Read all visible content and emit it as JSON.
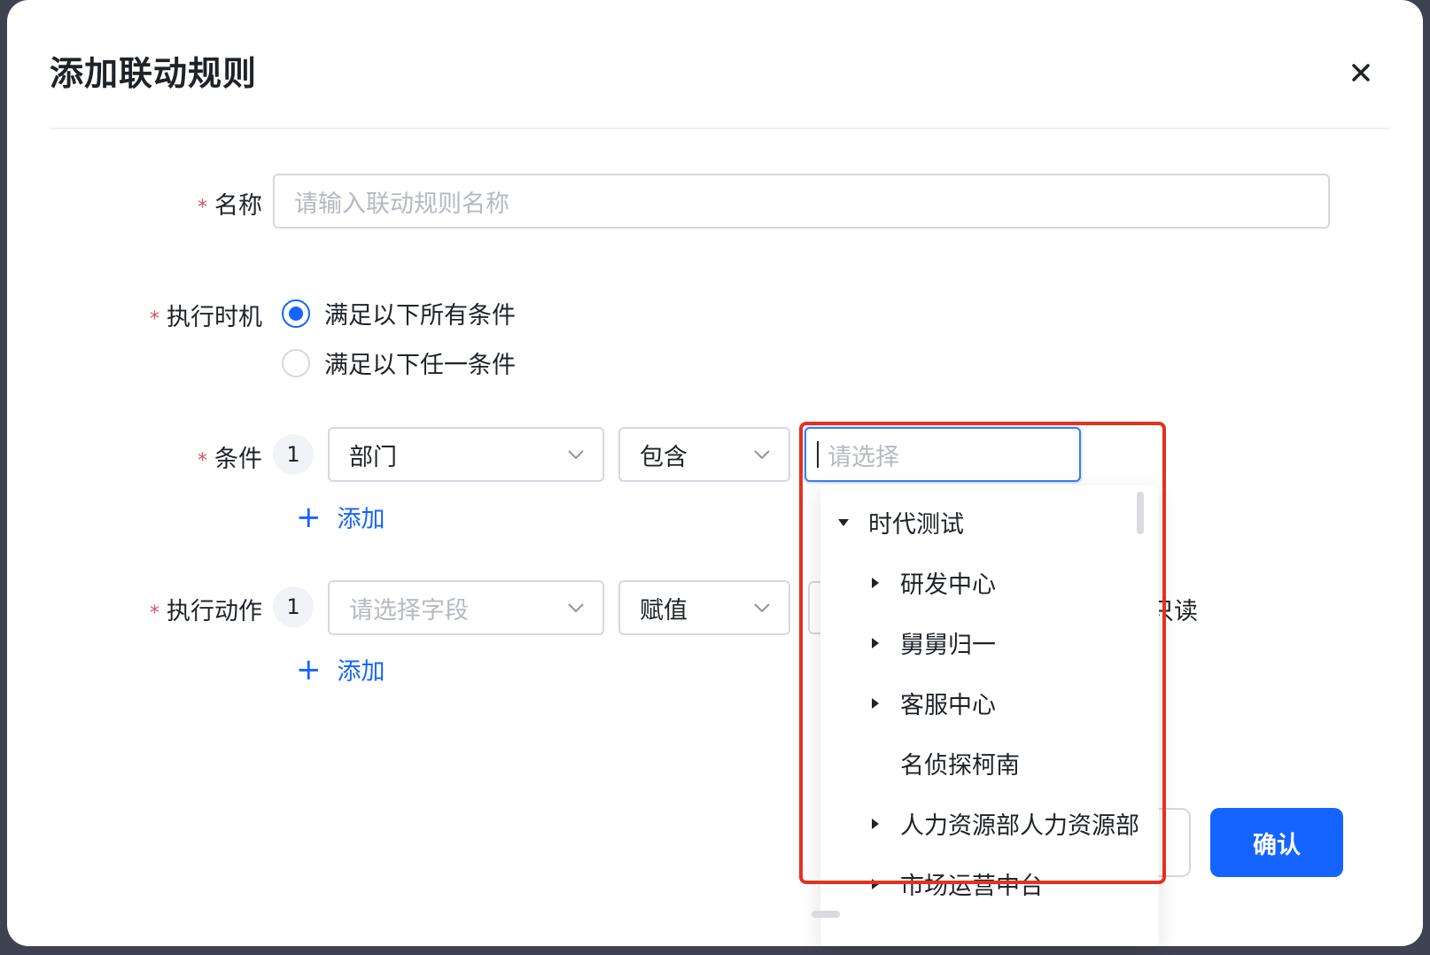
{
  "dialog": {
    "title": "添加联动规则"
  },
  "form": {
    "name": {
      "label": "名称",
      "placeholder": "请输入联动规则名称"
    },
    "timing": {
      "label": "执行时机",
      "options": [
        {
          "label": "满足以下所有条件",
          "selected": true
        },
        {
          "label": "满足以下任一条件",
          "selected": false
        }
      ]
    },
    "condition": {
      "label": "条件",
      "index": "1",
      "field": "部门",
      "operator": "包含",
      "value_placeholder": "请选择",
      "add_label": "添加"
    },
    "action": {
      "label": "执行动作",
      "index": "1",
      "field_placeholder": "请选择字段",
      "operator": "赋值",
      "add_label": "添加",
      "trailing_text": "只读"
    }
  },
  "dropdown": {
    "tree": [
      {
        "label": "时代测试",
        "expanded": true,
        "level": 0
      },
      {
        "label": "研发中心",
        "expanded": false,
        "level": 1,
        "has_children": true
      },
      {
        "label": "舅舅归一",
        "expanded": false,
        "level": 1,
        "has_children": true
      },
      {
        "label": "客服中心",
        "expanded": false,
        "level": 1,
        "has_children": true
      },
      {
        "label": "名侦探柯南",
        "level": 1,
        "has_children": false
      },
      {
        "label": "人力资源部人力资源部",
        "expanded": false,
        "level": 1,
        "has_children": true
      },
      {
        "label": "市场运营中台",
        "expanded": false,
        "level": 1,
        "has_children": true
      }
    ]
  },
  "footer": {
    "confirm_label": "确认"
  },
  "colors": {
    "primary": "#1664ff",
    "required": "#e34d59",
    "highlight": "#e5311f"
  }
}
